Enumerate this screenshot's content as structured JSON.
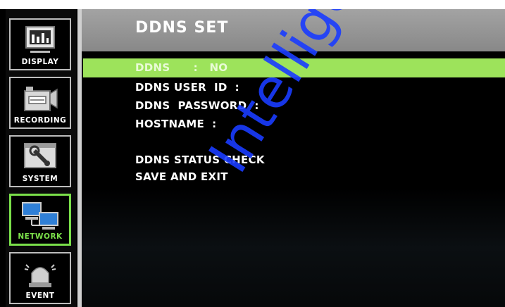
{
  "sidebar": {
    "items": [
      {
        "label": "DISPLAY",
        "icon": "display-icon"
      },
      {
        "label": "RECORDING",
        "icon": "camcorder-icon"
      },
      {
        "label": "SYSTEM",
        "icon": "wrench-icon"
      },
      {
        "label": "NETWORK",
        "icon": "network-computers-icon",
        "active": true
      },
      {
        "label": "EVENT",
        "icon": "alarm-light-icon"
      }
    ]
  },
  "header": {
    "title": "DDNS  SET"
  },
  "menu": {
    "ddns": "DDNS      :   NO",
    "user_id": "DDNS USER  ID  :",
    "password": "DDNS  PASSWORD  :",
    "hostname": "HOSTNAME  :",
    "status_check": "DDNS STATUS CHECK",
    "save_exit": "SAVE AND EXIT"
  },
  "watermark": "Intelligent Se",
  "colors": {
    "active": "#7be04a",
    "highlight": "#9de35b",
    "title_bar": "#999999",
    "watermark": "#1a3cff"
  }
}
